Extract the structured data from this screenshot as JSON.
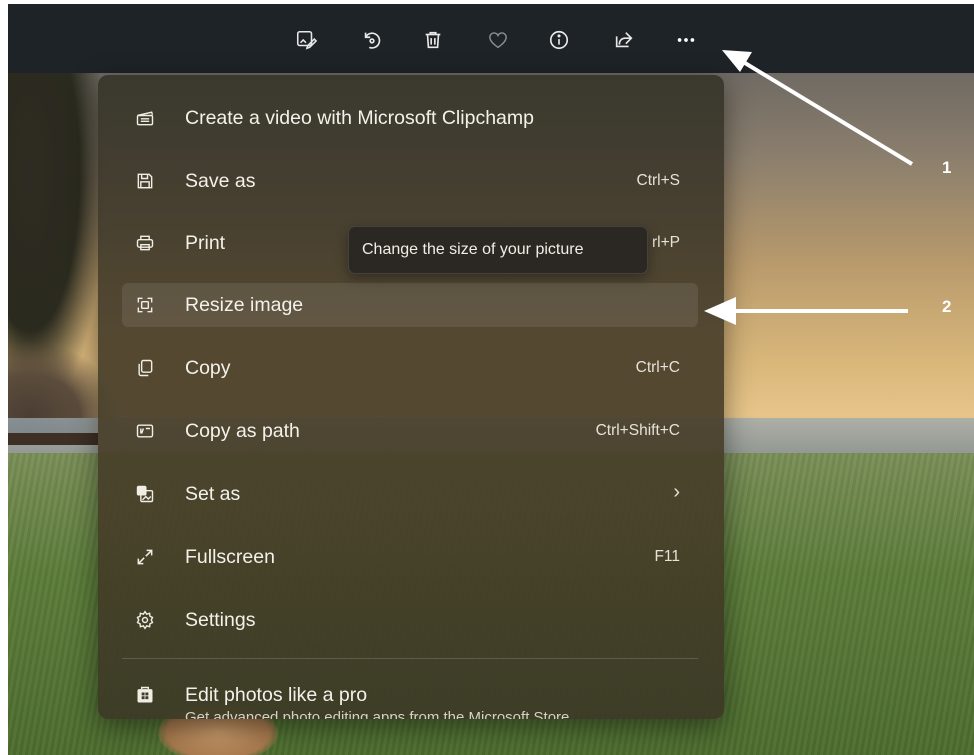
{
  "toolbar": {
    "buttons": [
      {
        "icon": "edit-image-icon",
        "label": "Edit image"
      },
      {
        "icon": "rotate-icon",
        "label": "Rotate"
      },
      {
        "icon": "delete-icon",
        "label": "Delete"
      },
      {
        "icon": "favorite-heart-icon",
        "label": "Favorite"
      },
      {
        "icon": "info-icon",
        "label": "File info"
      },
      {
        "icon": "share-icon",
        "label": "Share"
      },
      {
        "icon": "more-options-icon",
        "label": "See more"
      }
    ]
  },
  "menu": {
    "items": [
      {
        "icon": "clipchamp-icon",
        "label": "Create a video with Microsoft Clipchamp",
        "shortcut": ""
      },
      {
        "icon": "save-icon",
        "label": "Save as",
        "shortcut": "Ctrl+S"
      },
      {
        "icon": "print-icon",
        "label": "Print",
        "shortcut": "rl+P"
      },
      {
        "icon": "resize-icon",
        "label": "Resize image",
        "shortcut": ""
      },
      {
        "icon": "copy-icon",
        "label": "Copy",
        "shortcut": "Ctrl+C"
      },
      {
        "icon": "copy-path-icon",
        "label": "Copy as path",
        "shortcut": "Ctrl+Shift+C"
      },
      {
        "icon": "set-as-icon",
        "label": "Set as",
        "shortcut": "›"
      },
      {
        "icon": "fullscreen-icon",
        "label": "Fullscreen",
        "shortcut": "F11"
      },
      {
        "icon": "settings-icon",
        "label": "Settings",
        "shortcut": ""
      }
    ],
    "pro": {
      "label": "Edit photos like a pro",
      "subtitle": "Get advanced photo editing apps from the Microsoft Store"
    }
  },
  "tooltip": {
    "text": "Change the size of your picture"
  },
  "annotations": [
    {
      "number": "1"
    },
    {
      "number": "2"
    }
  ],
  "colors": {
    "toolbar_bg": "#1e2328",
    "menu_text": "#f3f1ea",
    "annotation": "#ffffff"
  }
}
